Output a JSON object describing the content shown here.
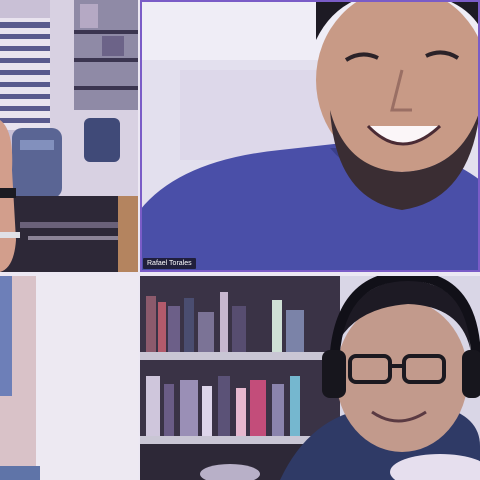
{
  "gallery": {
    "tiles": [
      {
        "participant_name": "",
        "id": "top-left"
      },
      {
        "participant_name": "Rafael Torales",
        "id": "top-right",
        "active_speaker": true
      },
      {
        "participant_name": "",
        "id": "bottom-left"
      },
      {
        "participant_name": "",
        "id": "bottom-right"
      }
    ]
  },
  "colors": {
    "active_speaker_border": "#7a5cc7",
    "tile_gap": "#ece8f3",
    "tint": "#6f68b8"
  }
}
